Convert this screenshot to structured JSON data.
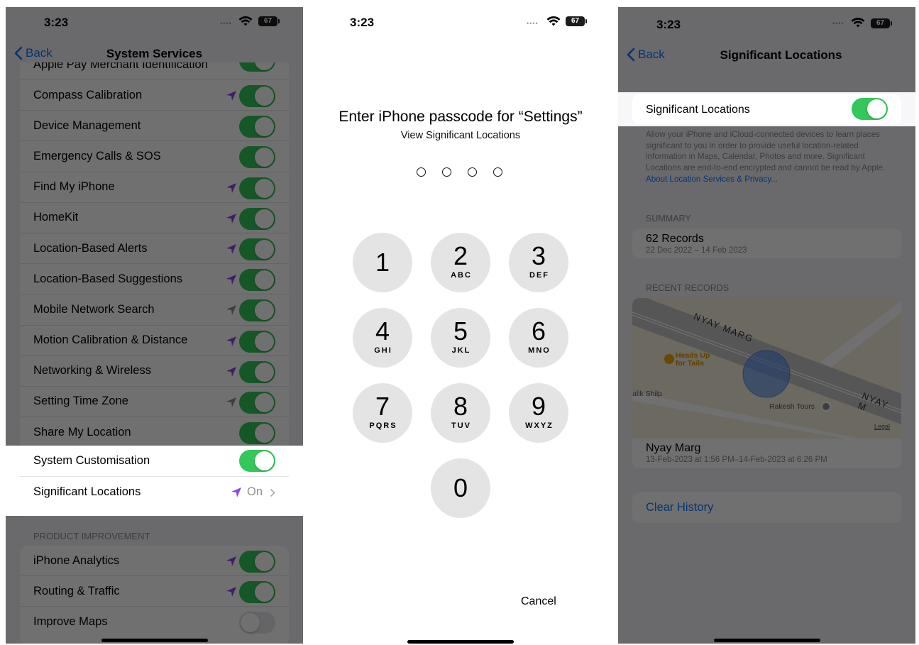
{
  "status_bar": {
    "time": "3:23",
    "battery": "67"
  },
  "panel1": {
    "back_label": "Back",
    "title": "System Services",
    "partial_row": "Apple Pay Merchant Identification",
    "rows": [
      {
        "label": "Compass Calibration",
        "location_arrow": "purple",
        "toggle": "on"
      },
      {
        "label": "Device Management",
        "location_arrow": "none",
        "toggle": "on"
      },
      {
        "label": "Emergency Calls & SOS",
        "location_arrow": "none",
        "toggle": "on"
      },
      {
        "label": "Find My iPhone",
        "location_arrow": "purple",
        "toggle": "on"
      },
      {
        "label": "HomeKit",
        "location_arrow": "purple",
        "toggle": "on"
      },
      {
        "label": "Location-Based Alerts",
        "location_arrow": "purple",
        "toggle": "on"
      },
      {
        "label": "Location-Based Suggestions",
        "location_arrow": "purple",
        "toggle": "on"
      },
      {
        "label": "Mobile Network Search",
        "location_arrow": "gray",
        "toggle": "on"
      },
      {
        "label": "Motion Calibration & Distance",
        "location_arrow": "purple",
        "toggle": "on"
      },
      {
        "label": "Networking & Wireless",
        "location_arrow": "purple",
        "toggle": "on"
      },
      {
        "label": "Setting Time Zone",
        "location_arrow": "gray",
        "toggle": "on"
      },
      {
        "label": "Share My Location",
        "location_arrow": "none",
        "toggle": "on"
      }
    ],
    "highlight_rows": {
      "system_customisation": "System Customisation",
      "significant_locations": "Significant Locations",
      "significant_value": "On"
    },
    "product_improvement_header": "PRODUCT IMPROVEMENT",
    "product_rows": [
      {
        "label": "iPhone Analytics",
        "location_arrow": "purple",
        "toggle": "on"
      },
      {
        "label": "Routing & Traffic",
        "location_arrow": "purple",
        "toggle": "on"
      },
      {
        "label": "Improve Maps",
        "location_arrow": "none",
        "toggle": "off"
      }
    ]
  },
  "panel2": {
    "title": "Enter iPhone passcode for “Settings”",
    "subtitle": "View Significant Locations",
    "keys": [
      {
        "digit": "1",
        "letters": ""
      },
      {
        "digit": "2",
        "letters": "ABC"
      },
      {
        "digit": "3",
        "letters": "DEF"
      },
      {
        "digit": "4",
        "letters": "GHI"
      },
      {
        "digit": "5",
        "letters": "JKL"
      },
      {
        "digit": "6",
        "letters": "MNO"
      },
      {
        "digit": "7",
        "letters": "PQRS"
      },
      {
        "digit": "8",
        "letters": "TUV"
      },
      {
        "digit": "9",
        "letters": "WXYZ"
      },
      {
        "digit": "0",
        "letters": ""
      }
    ],
    "cancel": "Cancel"
  },
  "panel3": {
    "back_label": "Back",
    "title": "Significant Locations",
    "toggle_label": "Significant Locations",
    "description": "Allow your iPhone and iCloud-connected devices to learn places significant to you in order to provide useful location-related information in Maps, Calendar, Photos and more. Significant Locations are end-to-end encrypted and cannot be read by Apple.",
    "privacy_link": "About Location Services & Privacy...",
    "summary_header": "SUMMARY",
    "records_title": "62 Records",
    "records_range": "22 Dec 2022 – 14 Feb 2023",
    "recent_header": "RECENT RECORDS",
    "map": {
      "road_label_1": "NYAY MARG",
      "road_label_2": "NYAY M",
      "poi_1": "Heads Up for Tails",
      "poi_2": "alik Shilp",
      "poi_3": "Rakesh Tours",
      "legal": "Legal"
    },
    "place_title": "Nyay Marg",
    "place_time": "13-Feb-2023 at 1:56 PM–14-Feb-2023 at 6:26 PM",
    "clear_history": "Clear History"
  },
  "colors": {
    "accent": "#0a7aff",
    "toggle_on": "#34c759",
    "location_purple": "#8e44ec",
    "location_gray": "#8e8e93",
    "dim_overlay": "rgba(0,0,0,0.56)"
  }
}
